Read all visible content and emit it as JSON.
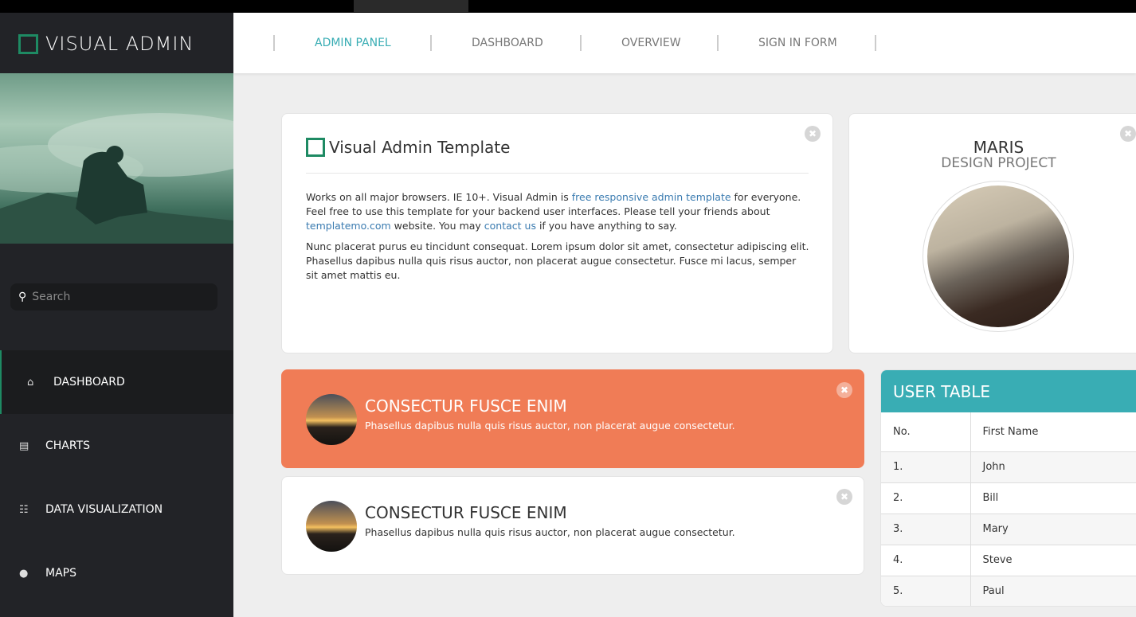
{
  "app": {
    "title": "VISUAL ADMIN"
  },
  "search": {
    "placeholder": "Search"
  },
  "sidebar": {
    "items": [
      {
        "label": "DASHBOARD",
        "icon": "home-icon",
        "active": true
      },
      {
        "label": "CHARTS",
        "icon": "bar-chart-icon"
      },
      {
        "label": "DATA VISUALIZATION",
        "icon": "database-icon"
      },
      {
        "label": "MAPS",
        "icon": "map-marker-icon"
      }
    ]
  },
  "header": {
    "menu": [
      "ADMIN PANEL",
      "DASHBOARD",
      "OVERVIEW",
      "SIGN IN FORM"
    ],
    "active_color": "#39adb4"
  },
  "intro": {
    "title": "Visual Admin Template",
    "p1_a": "Works on all major browsers. IE 10+. Visual Admin is ",
    "p1_link1": "free responsive admin template",
    "p1_b": " for everyone. Feel free to use this template for your backend user interfaces. Please tell your friends about ",
    "p1_link2": "templatemo.com",
    "p1_c": " website. You may ",
    "p1_link3": "contact us",
    "p1_d": " if you have anything to say.",
    "p2": "Nunc placerat purus eu tincidunt consequat. Lorem ipsum dolor sit amet, consectetur adipiscing elit. Phasellus dapibus nulla quis risus auctor, non placerat augue consectetur. Fusce mi lacus, semper sit amet mattis eu."
  },
  "profile": {
    "name": "MARIS",
    "subtitle": "DESIGN PROJECT"
  },
  "media": [
    {
      "title": "CONSECTUR FUSCE ENIM",
      "text": "Phasellus dapibus nulla quis risus auctor, non placerat augue consectetur.",
      "bg": "#f07c56"
    },
    {
      "title": "CONSECTUR FUSCE ENIM",
      "text": "Phasellus dapibus nulla quis risus auctor, non placerat augue consectetur.",
      "bg": "#ffffff"
    }
  ],
  "user_table": {
    "title": "USER TABLE",
    "headers": [
      "No.",
      "First Name"
    ],
    "rows": [
      [
        "1.",
        "John"
      ],
      [
        "2.",
        "Bill"
      ],
      [
        "3.",
        "Mary"
      ],
      [
        "4.",
        "Steve"
      ],
      [
        "5.",
        "Paul"
      ]
    ],
    "color": "#39adb4"
  }
}
